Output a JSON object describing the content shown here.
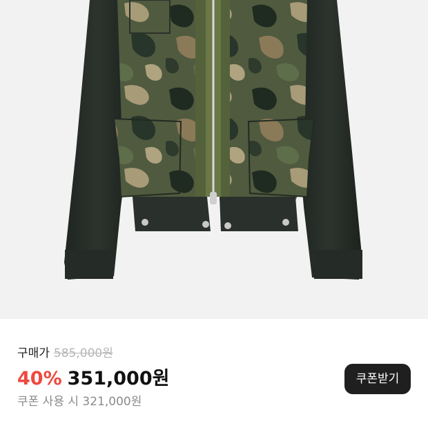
{
  "product": {
    "image_alt": "camouflage denim jacket"
  },
  "pricing": {
    "buy_label": "구매가",
    "original_price": "585,000원",
    "discount_rate": "40%",
    "sale_price": "351,000원",
    "coupon_price_text": "쿠폰 사용 시 321,000원"
  },
  "actions": {
    "coupon_button_label": "쿠폰받기"
  },
  "colors": {
    "discount": "#ee4a3e",
    "button_bg": "#1f1f1f",
    "strikethrough": "#b5b5b5"
  }
}
